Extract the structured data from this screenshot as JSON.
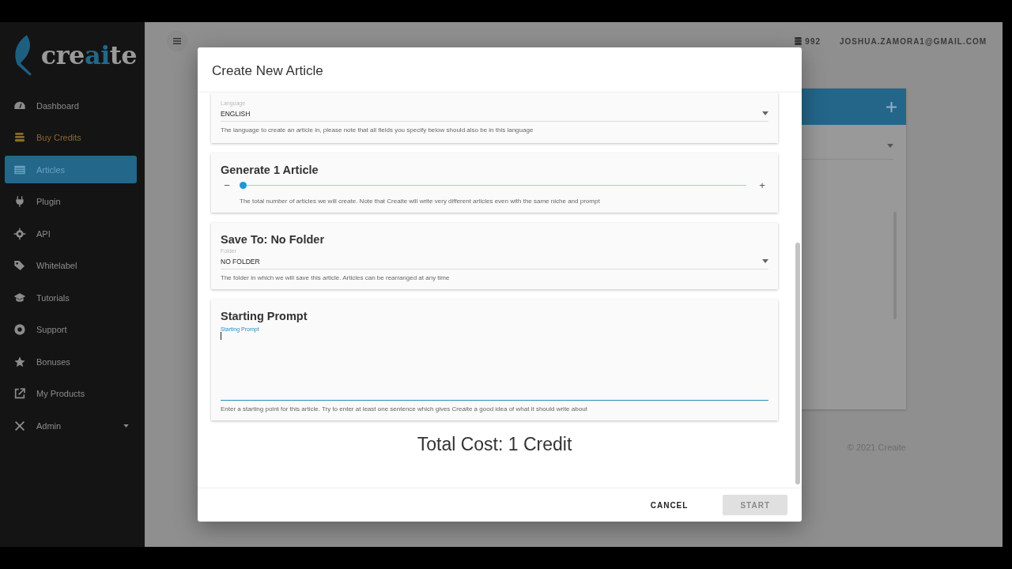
{
  "brand": {
    "pre": "cre",
    "accent": "ai",
    "post": "te"
  },
  "sidebar": {
    "items": [
      {
        "label": "Dashboard",
        "selected": false,
        "highlight": false,
        "expandable": false
      },
      {
        "label": "Buy Credits",
        "selected": false,
        "highlight": true,
        "expandable": false
      },
      {
        "label": "Articles",
        "selected": true,
        "highlight": false,
        "expandable": false
      },
      {
        "label": "Plugin",
        "selected": false,
        "highlight": false,
        "expandable": false
      },
      {
        "label": "API",
        "selected": false,
        "highlight": false,
        "expandable": false
      },
      {
        "label": "Whitelabel",
        "selected": false,
        "highlight": false,
        "expandable": false
      },
      {
        "label": "Tutorials",
        "selected": false,
        "highlight": false,
        "expandable": false
      },
      {
        "label": "Support",
        "selected": false,
        "highlight": false,
        "expandable": false
      },
      {
        "label": "Bonuses",
        "selected": false,
        "highlight": false,
        "expandable": false
      },
      {
        "label": "My Products",
        "selected": false,
        "highlight": false,
        "expandable": false
      },
      {
        "label": "Admin",
        "selected": false,
        "highlight": false,
        "expandable": true
      }
    ]
  },
  "topbar": {
    "credits": "992",
    "email": "JOSHUA.ZAMORA1@GMAIL.COM"
  },
  "footer": "© 2021 Creaite",
  "dialog": {
    "title": "Create New Article",
    "sections": [
      {
        "kind": "select",
        "label": "Language",
        "value": "ENGLISH",
        "help": "The language to create an article in, please note that all fields you specify below should also be in this language"
      },
      {
        "kind": "slider",
        "heading": "Generate 1 Article",
        "minus": "−",
        "plus": "+",
        "level": 0,
        "help": "The total number of articles we will create. Note that Creaite will write very different articles even with the same niche and prompt"
      },
      {
        "kind": "select",
        "heading": "Save To: No Folder",
        "label": "Folder",
        "value": "NO FOLDER",
        "help": "The folder in which we will save this article. Articles can be rearranged at any time"
      },
      {
        "kind": "textarea",
        "heading": "Starting Prompt",
        "label": "Starting Prompt",
        "help": "Enter a starting point for this article. Try to enter at least one sentence which gives Creaite a good idea of what it should write about"
      }
    ],
    "total": "Total Cost: 1 Credit",
    "buttons": [
      {
        "label": "CANCEL",
        "disabled": false
      },
      {
        "label": "START",
        "disabled": true
      }
    ]
  }
}
